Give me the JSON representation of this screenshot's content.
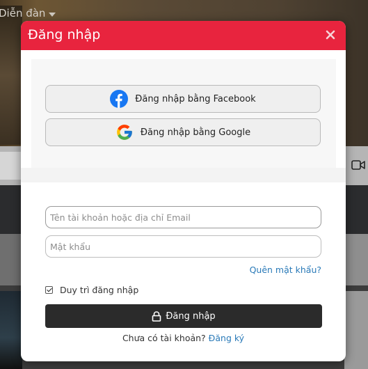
{
  "background": {
    "nav_label": "Diễn đàn"
  },
  "modal": {
    "title": "Đăng nhập",
    "social": {
      "facebook_label": "Đăng nhập bằng Facebook",
      "google_label": "Đăng nhập bằng Google"
    },
    "form": {
      "username_placeholder": "Tên tài khoản hoặc địa chỉ Email",
      "password_placeholder": "Mật khẩu",
      "forgot_label": "Quên mật khẩu?",
      "remember_label": "Duy trì đăng nhập",
      "remember_checked": true,
      "submit_label": "Đăng nhập"
    },
    "signup": {
      "prompt": "Chưa có tài khoản?",
      "link_label": "Đăng ký"
    }
  },
  "colors": {
    "header_red": "#e8243e",
    "button_dark": "#2b2b2b",
    "link_blue": "#2a7ab8",
    "facebook_blue": "#1877f2"
  },
  "icons": {
    "close": "close-icon",
    "facebook": "facebook-icon",
    "google": "google-icon",
    "lock": "lock-icon",
    "checkbox": "checkmark-icon"
  }
}
